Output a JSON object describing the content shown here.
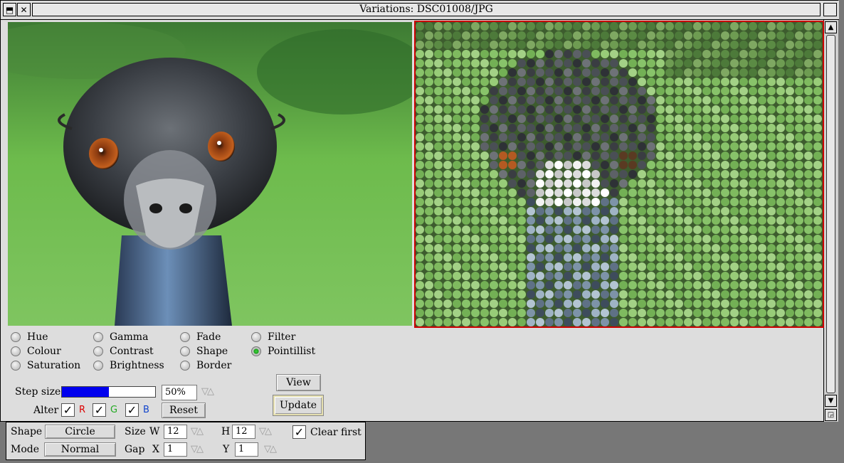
{
  "window": {
    "title": "Variations: DSC01008/JPG"
  },
  "options_col1": [
    "Hue",
    "Colour",
    "Saturation"
  ],
  "options_col2": [
    "Gamma",
    "Contrast",
    "Brightness"
  ],
  "options_col3": [
    "Fade",
    "Shape",
    "Border"
  ],
  "options_col4": [
    "Filter",
    "Pointillist"
  ],
  "selected_option": "Pointillist",
  "step": {
    "label": "Step size",
    "value": "50%",
    "fraction": 0.5,
    "bar_color": "#0000ee"
  },
  "alter": {
    "label": "Alter",
    "r": "R",
    "g": "G",
    "b": "B",
    "r_color": "#dd0000",
    "g_color": "#22aa22",
    "b_color": "#1144cc",
    "r_checked": true,
    "g_checked": true,
    "b_checked": true
  },
  "buttons": {
    "reset": "Reset",
    "view": "View",
    "update": "Update"
  },
  "pane": {
    "shape_label": "Shape",
    "shape_value": "Circle",
    "size_label": "Size",
    "w_label": "W",
    "w_value": "12",
    "h_label": "H",
    "h_value": "12",
    "clear_first_label": "Clear first",
    "clear_first_checked": true,
    "mode_label": "Mode",
    "mode_value": "Normal",
    "gap_label": "Gap",
    "x_label": "X",
    "x_value": "1",
    "y_label": "Y",
    "y_value": "1"
  },
  "icons": {
    "back": "back-icon",
    "close": "close-icon",
    "toggle_size": "toggle-size-icon",
    "resize": "resize-icon",
    "up": "scroll-up-icon",
    "down": "scroll-down-icon"
  }
}
